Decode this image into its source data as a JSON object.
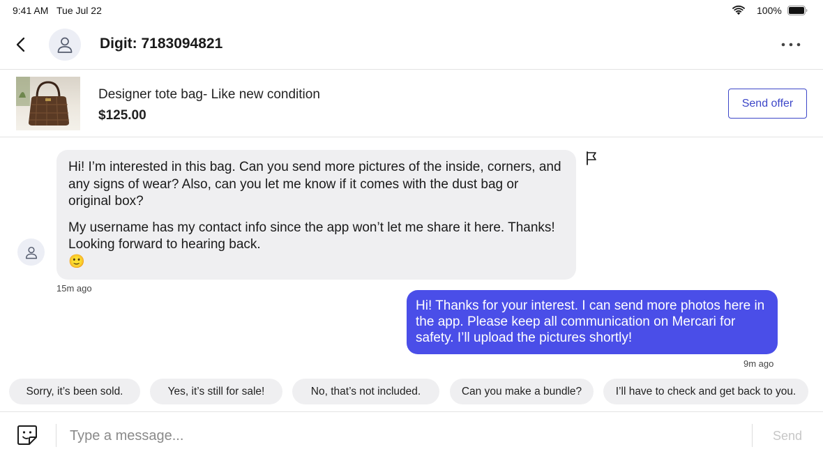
{
  "status_bar": {
    "time": "9:41 AM",
    "date": "Tue Jul 22",
    "battery": "100%"
  },
  "header": {
    "title": "Digit: 7183094821",
    "back_icon": "chevron-left-icon",
    "more_icon": "ellipsis-icon",
    "avatar_icon": "user-icon"
  },
  "item": {
    "name": "Designer tote bag- Like new condition",
    "price": "$125.00",
    "offer_label": "Send offer"
  },
  "messages": [
    {
      "direction": "incoming",
      "paragraphs": [
        "Hi! I’m interested in this bag. Can you send more pictures of the inside, corners, and any signs of wear? Also, can you let me know if it comes with the dust bag or original box?",
        "My username has my contact info since the app won’t let me share it here. Thanks! Looking forward to hearing back.",
        "🙂"
      ],
      "time": "15m ago"
    },
    {
      "direction": "outgoing",
      "text": "Hi! Thanks for your interest. I can send more photos here in the app. Please keep all communication on Mercari for safety. I’ll upload the pictures shortly!",
      "time": "9m ago"
    }
  ],
  "quick_replies": [
    "Sorry, it’s been sold.",
    "Yes, it’s still for sale!",
    "No, that’s not included.",
    "Can you make a bundle?",
    "I’ll have to check and get back to you."
  ],
  "composer": {
    "placeholder": "Type a message...",
    "send_label": "Send"
  },
  "colors": {
    "accent": "#3c46c8",
    "outgoing_bubble": "#4a4ee8",
    "incoming_bubble": "#efeff1"
  }
}
